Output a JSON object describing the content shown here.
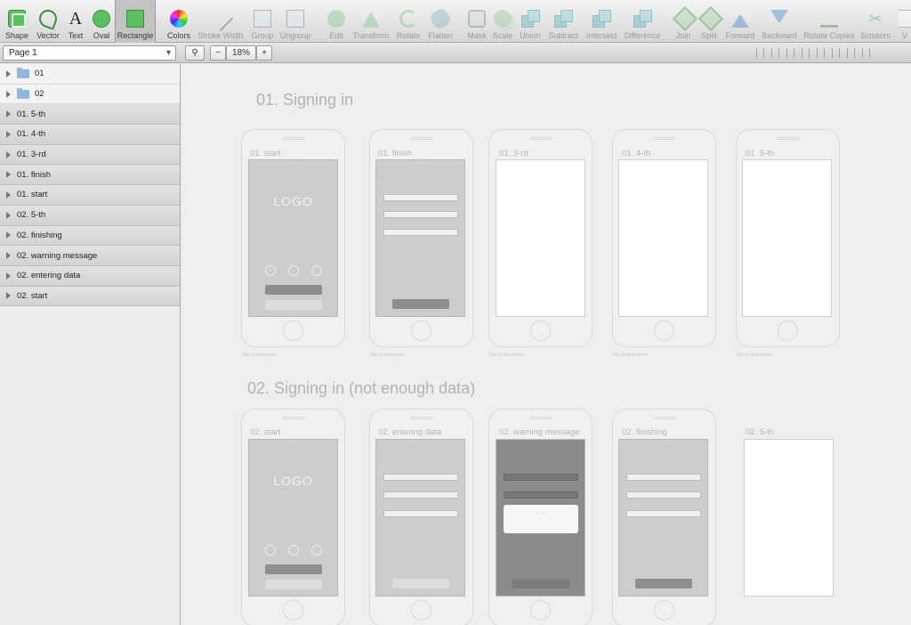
{
  "toolbar": {
    "tools": [
      {
        "label": "Shape",
        "icon": "shape-icon"
      },
      {
        "label": "Vector",
        "icon": "vector-pen-icon"
      },
      {
        "label": "Text",
        "icon": "text-icon"
      },
      {
        "label": "Oval",
        "icon": "oval-icon"
      },
      {
        "label": "Rectangle",
        "icon": "rectangle-icon"
      },
      {
        "label": "Colors",
        "icon": "color-wheel-icon"
      },
      {
        "label": "Stroke Width",
        "icon": "stroke-width-icon"
      },
      {
        "label": "Group",
        "icon": "group-icon"
      },
      {
        "label": "Ungroup",
        "icon": "ungroup-icon"
      },
      {
        "label": "Edit",
        "icon": "edit-icon"
      },
      {
        "label": "Transform",
        "icon": "transform-icon"
      },
      {
        "label": "Rotate",
        "icon": "rotate-icon"
      },
      {
        "label": "Flatten",
        "icon": "flatten-icon"
      },
      {
        "label": "Mask",
        "icon": "mask-icon"
      },
      {
        "label": "Scale",
        "icon": "scale-icon"
      },
      {
        "label": "Union",
        "icon": "union-icon"
      },
      {
        "label": "Subtract",
        "icon": "subtract-icon"
      },
      {
        "label": "Intersect",
        "icon": "intersect-icon"
      },
      {
        "label": "Difference",
        "icon": "difference-icon"
      },
      {
        "label": "Join",
        "icon": "join-icon"
      },
      {
        "label": "Split",
        "icon": "split-icon"
      },
      {
        "label": "Forward",
        "icon": "forward-icon"
      },
      {
        "label": "Backward",
        "icon": "backward-icon"
      },
      {
        "label": "Rotate Copies",
        "icon": "rotate-copies-icon"
      },
      {
        "label": "Scissors",
        "icon": "scissors-icon"
      },
      {
        "label": "V",
        "icon": "view-icon"
      }
    ]
  },
  "subbar": {
    "page_name": "Page 1",
    "search_icon": "search-icon",
    "zoom_out": "−",
    "zoom_level": "18%",
    "zoom_in": "+"
  },
  "sidebar": {
    "layers": [
      {
        "label": "01",
        "type": "folder"
      },
      {
        "label": "02",
        "type": "folder"
      },
      {
        "label": "01. 5-th",
        "type": "artboard"
      },
      {
        "label": "01. 4-th",
        "type": "artboard"
      },
      {
        "label": "01. 3-rd",
        "type": "artboard"
      },
      {
        "label": "01. finish",
        "type": "artboard"
      },
      {
        "label": "01. start",
        "type": "artboard"
      },
      {
        "label": "02. 5-th",
        "type": "artboard"
      },
      {
        "label": "02. finishing",
        "type": "artboard"
      },
      {
        "label": "02. warning message",
        "type": "artboard"
      },
      {
        "label": "02. entering data",
        "type": "artboard"
      },
      {
        "label": "02. start",
        "type": "artboard"
      }
    ]
  },
  "canvas": {
    "section1_title": "01. Signing in",
    "section2_title": "02. Signing in (not enough data)",
    "row1_labels": [
      "01. start",
      "01. finish",
      "01. 3-rd",
      "01. 4-th",
      "01. 5-th"
    ],
    "row2_labels": [
      "02. start",
      "02. entering data",
      "02. warning message",
      "02. finishing",
      "02. 5-th"
    ],
    "logo_text": "LOGO",
    "caption_text": "Title of description"
  }
}
